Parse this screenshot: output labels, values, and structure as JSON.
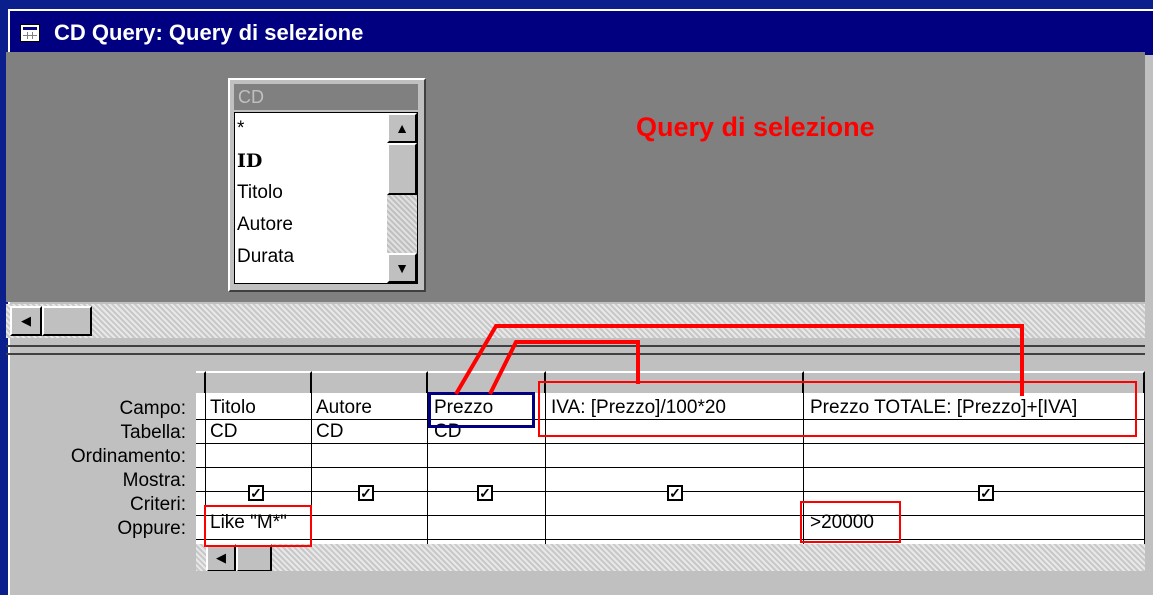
{
  "window": {
    "title": "CD Query: Query di selezione"
  },
  "table_list": {
    "name": "CD",
    "fields": [
      "*",
      "ID",
      "Titolo",
      "Autore",
      "Durata"
    ]
  },
  "annotation": {
    "title": "Query di selezione"
  },
  "grid": {
    "row_labels": [
      "Campo:",
      "Tabella:",
      "Ordinamento:",
      "Mostra:",
      "Criteri:",
      "Oppure:"
    ],
    "columns": [
      {
        "field": "Titolo",
        "table": "CD",
        "sort": "",
        "show": true,
        "criteria": "Like \"M*\""
      },
      {
        "field": "Autore",
        "table": "CD",
        "sort": "",
        "show": true,
        "criteria": ""
      },
      {
        "field": "Prezzo",
        "table": "CD",
        "sort": "",
        "show": true,
        "criteria": ""
      },
      {
        "field": "IVA: [Prezzo]/100*20",
        "table": "",
        "sort": "",
        "show": true,
        "criteria": ""
      },
      {
        "field": "Prezzo TOTALE: [Prezzo]+[IVA]",
        "table": "",
        "sort": "",
        "show": true,
        "criteria": ">20000"
      }
    ]
  },
  "icons": {
    "window": "query-window-icon",
    "scroll_up": "arrow-up-icon",
    "scroll_down": "arrow-down-icon",
    "scroll_left": "arrow-left-icon",
    "checkbox": "checkbox-checked-icon"
  },
  "colors": {
    "desktop": "#0b1f8c",
    "titlebar": "#000080",
    "annotation": "#ff0000",
    "highlight": "#000080"
  }
}
